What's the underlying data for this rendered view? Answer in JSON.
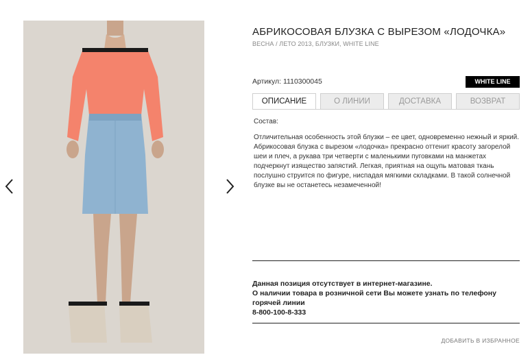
{
  "product": {
    "title": "АБРИКОСОВАЯ БЛУЗКА С ВЫРЕЗОМ «ЛОДОЧКА»",
    "breadcrumb": "ВЕСНА / ЛЕТО 2013, БЛУЗКИ, WHITE LINE",
    "article_label": "Артикул:",
    "article_value": "1110300045",
    "brand_badge": "WHITE LINE"
  },
  "tabs": [
    {
      "label": "ОПИСАНИЕ",
      "active": true
    },
    {
      "label": "О ЛИНИИ",
      "active": false
    },
    {
      "label": "ДОСТАВКА",
      "active": false
    },
    {
      "label": "ВОЗВРАТ",
      "active": false
    }
  ],
  "description": {
    "composition_label": "Состав:",
    "text": "Отличительная особенность этой блузки – ее цвет, одновременно нежный и яркий. Абрикосовая блузка с вырезом «лодочка» прекрасно оттенит красоту загорелой шеи и плеч, а рукава три четверти с маленькими пуговками на манжетах подчеркнут изящество запястий. Легкая, приятная на ощупь матовая ткань послушно струится по фигуре, ниспадая мягкими складками. В такой солнечной блузке вы не останетесь незамеченной!"
  },
  "availability": {
    "line1": "Данная позиция отсутствует в интернет-магазине.",
    "line2": "О наличии товара в розничной сети Вы можете узнать по телефону горячей линии",
    "phone": "8-800-100-8-333"
  },
  "actions": {
    "add_to_favorites": "ДОБАВИТЬ В ИЗБРАННОЕ"
  },
  "gallery": {
    "prev_icon": "chevron-left-icon",
    "next_icon": "chevron-right-icon"
  },
  "colors": {
    "blouse": "#f4836c",
    "skirt": "#8fb3d0",
    "badge_bg": "#000000",
    "photo_bg": "#dbd6cf"
  }
}
